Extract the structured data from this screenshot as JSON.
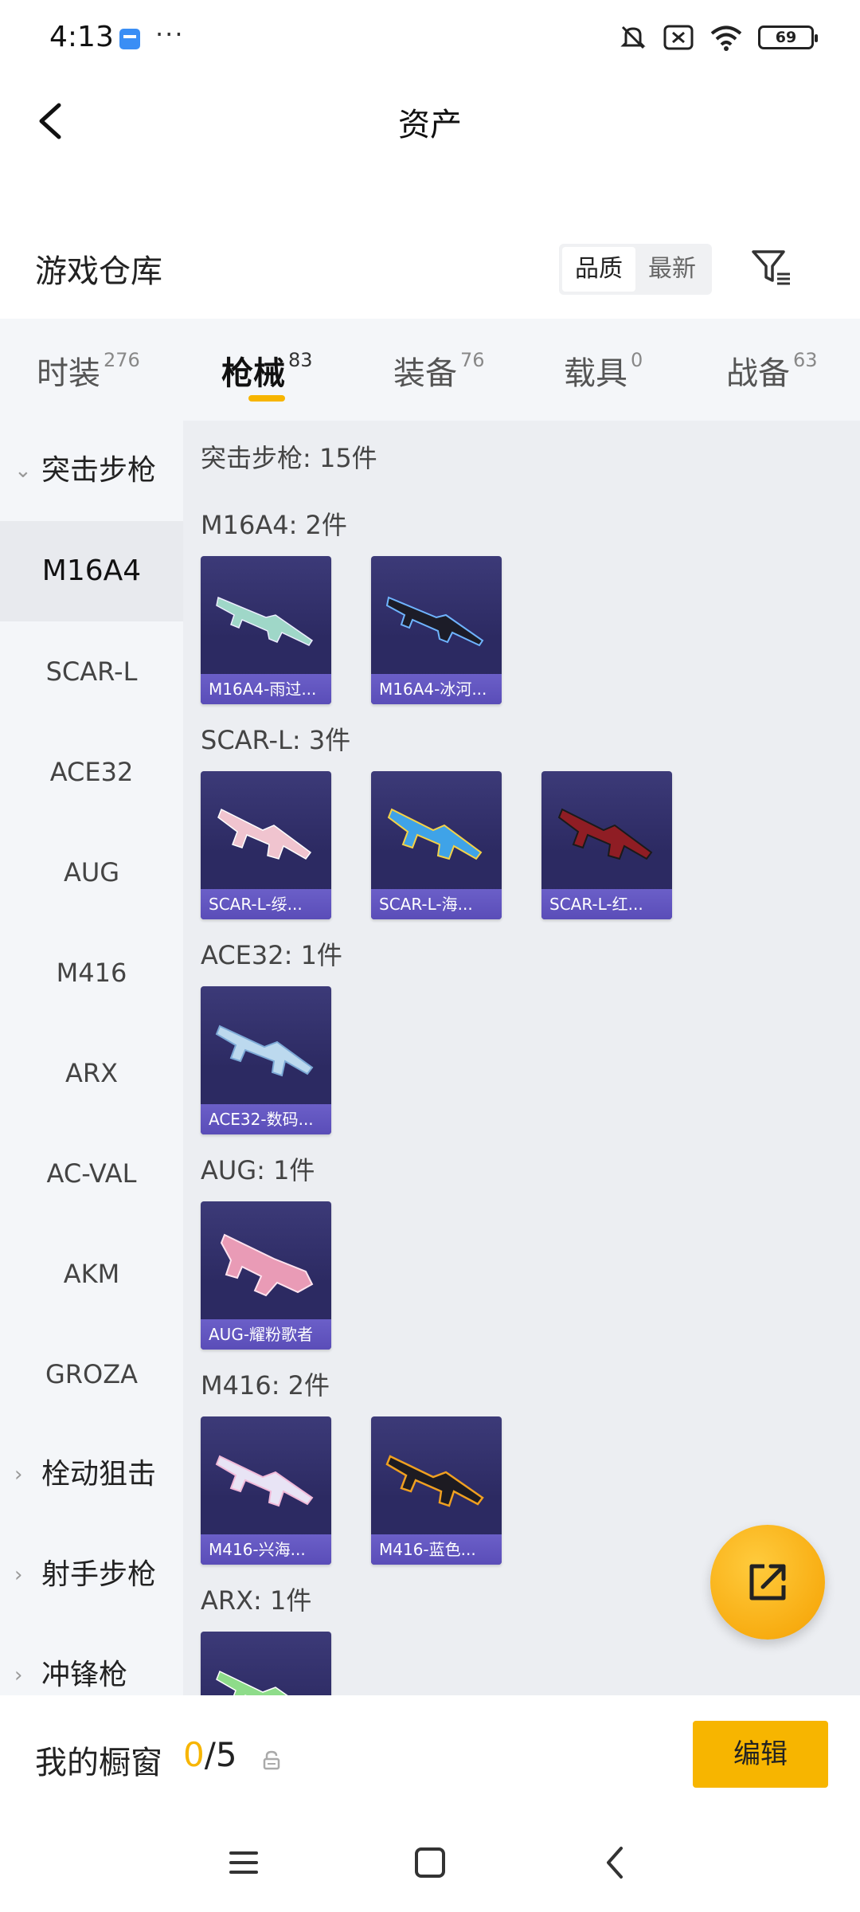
{
  "status_bar": {
    "time": "4:13",
    "dots": "···",
    "battery": "69"
  },
  "nav": {
    "title": "资产"
  },
  "warehouse": {
    "title": "游戏仓库",
    "sort_options": [
      "品质",
      "最新"
    ],
    "active_sort": "品质"
  },
  "category_tabs": [
    {
      "label": "时装",
      "count": "276"
    },
    {
      "label": "枪械",
      "count": "83"
    },
    {
      "label": "装备",
      "count": "76"
    },
    {
      "label": "载具",
      "count": "0"
    },
    {
      "label": "战备",
      "count": "63"
    }
  ],
  "active_tab": "枪械",
  "sidebar": {
    "group_expanded": "突击步枪",
    "items": [
      "M16A4",
      "SCAR-L",
      "ACE32",
      "AUG",
      "M416",
      "ARX",
      "AC-VAL",
      "AKM",
      "GROZA"
    ],
    "active_item": "M16A4",
    "collapsed_groups": [
      "栓动狙击",
      "射手步枪",
      "冲锋枪"
    ]
  },
  "content": {
    "summary": "突击步枪: 15件",
    "groups": [
      {
        "header": "M16A4: 2件",
        "items": [
          "M16A4-雨过...",
          "M16A4-冰河..."
        ]
      },
      {
        "header": "SCAR-L: 3件",
        "items": [
          "SCAR-L-绥...",
          "SCAR-L-海...",
          "SCAR-L-红..."
        ]
      },
      {
        "header": "ACE32: 1件",
        "items": [
          "ACE32-数码..."
        ]
      },
      {
        "header": "AUG: 1件",
        "items": [
          "AUG-耀粉歌者"
        ]
      },
      {
        "header": "M416: 2件",
        "items": [
          "M416-兴海...",
          "M416-蓝色..."
        ]
      },
      {
        "header": "ARX: 1件",
        "items": [
          ""
        ]
      }
    ]
  },
  "showcase": {
    "label": "我的橱窗",
    "current": "0",
    "max": "/5",
    "edit_label": "编辑"
  },
  "colors": {
    "accent": "#f7b500",
    "card_bg": "#2c2a62",
    "card_footer": "#5a4db8"
  },
  "icons": [
    "back-arrow-icon",
    "filter-icon",
    "share-icon",
    "lock-icon",
    "menu-icon",
    "home-icon",
    "back-nav-icon"
  ]
}
